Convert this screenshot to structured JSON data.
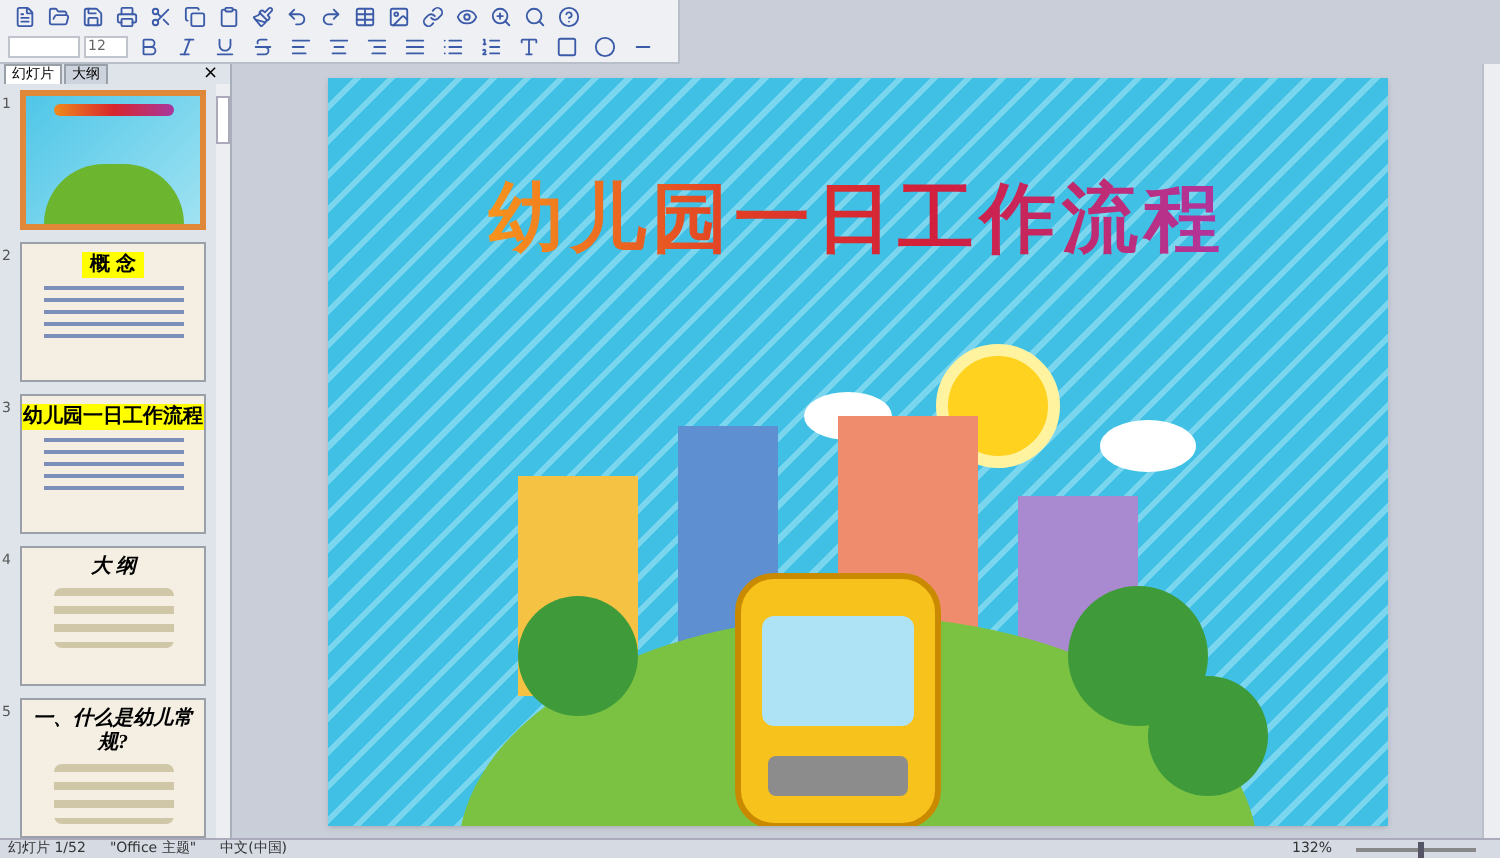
{
  "toolbar": {
    "font_size": "12"
  },
  "panel": {
    "tabs": [
      {
        "label": "幻灯片",
        "selected": true
      },
      {
        "label": "大纲",
        "selected": false
      }
    ],
    "close": "×"
  },
  "thumbnails": [
    {
      "number": "1",
      "kind": "cover",
      "selected": true
    },
    {
      "number": "2",
      "kind": "title",
      "title": "概 念",
      "selected": false
    },
    {
      "number": "3",
      "kind": "title",
      "title": "幼儿园一日工作流程",
      "selected": false
    },
    {
      "number": "4",
      "kind": "plain",
      "title": "大 纲",
      "selected": false
    },
    {
      "number": "5",
      "kind": "plain",
      "title": "一、什么是幼儿常规?",
      "selected": false
    }
  ],
  "slide": {
    "title": "幼儿园一日工作流程"
  },
  "status_bar": {
    "slide": "幻灯片 1/52",
    "theme": "\"Office 主题\"",
    "language": "中文(中国)",
    "zoom": "132%",
    "zoom_slider": {
      "level": 0.55
    }
  }
}
